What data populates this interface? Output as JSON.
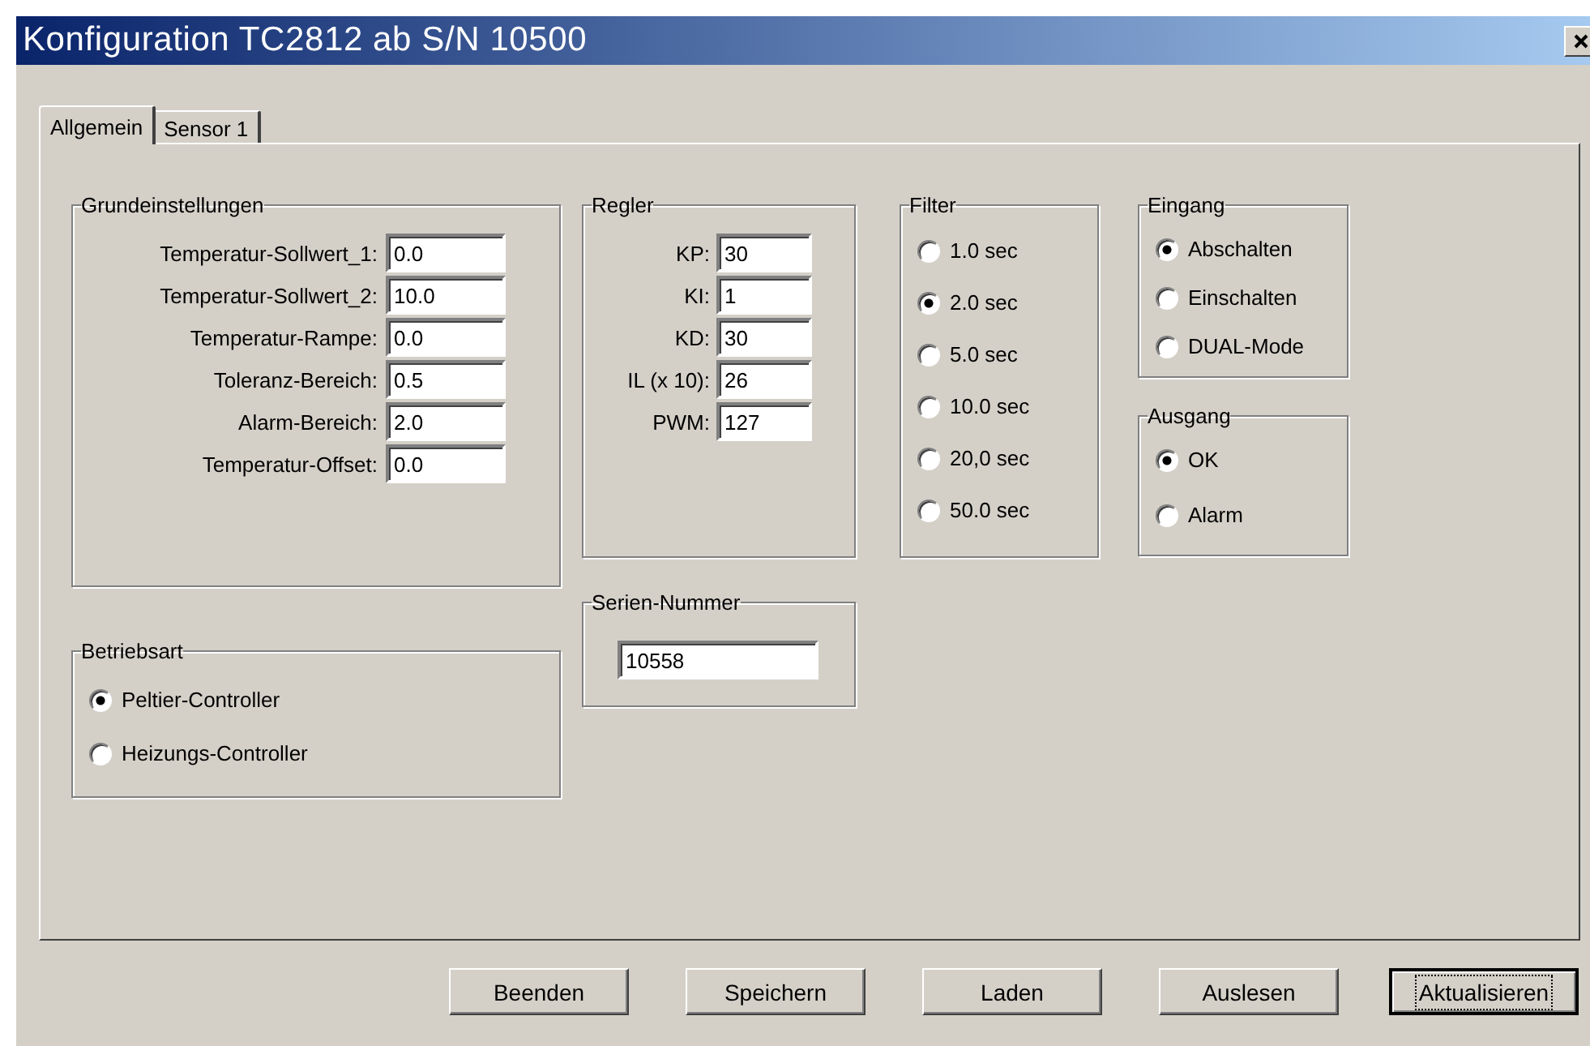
{
  "window": {
    "title": "Konfiguration TC2812 ab S/N 10500"
  },
  "tabs": [
    {
      "label": "Allgemein",
      "selected": true
    },
    {
      "label": "Sensor 1",
      "selected": false
    }
  ],
  "columns": [
    [
      {
        "kind": "fields",
        "title": "Grundeinstellungen",
        "fields": [
          {
            "label": "Temperatur-Sollwert_1:",
            "value": "0.0"
          },
          {
            "label": "Temperatur-Sollwert_2:",
            "value": "10.0"
          },
          {
            "label": "Temperatur-Rampe:",
            "value": "0.0"
          },
          {
            "label": "Toleranz-Bereich:",
            "value": "0.5"
          },
          {
            "label": "Alarm-Bereich:",
            "value": "2.0"
          },
          {
            "label": "Temperatur-Offset:",
            "value": "0.0"
          }
        ]
      },
      {
        "kind": "radios",
        "title": "Betriebsart",
        "options": [
          {
            "label": "Peltier-Controller",
            "selected": true
          },
          {
            "label": "Heizungs-Controller",
            "selected": false
          }
        ]
      }
    ],
    [
      {
        "kind": "fields",
        "title": "Regler",
        "fields": [
          {
            "label": "KP:",
            "value": "30"
          },
          {
            "label": "KI:",
            "value": "1"
          },
          {
            "label": "KD:",
            "value": "30"
          },
          {
            "label": "IL (x 10):",
            "value": "26"
          },
          {
            "label": "PWM:",
            "value": "127"
          }
        ]
      },
      {
        "kind": "field",
        "title": "Serien-Nummer",
        "value": "10558"
      }
    ],
    [
      {
        "kind": "radios",
        "title": "Filter",
        "options": [
          {
            "label": "1.0 sec",
            "selected": false
          },
          {
            "label": "2.0 sec",
            "selected": true
          },
          {
            "label": "5.0 sec",
            "selected": false
          },
          {
            "label": "10.0 sec",
            "selected": false
          },
          {
            "label": "20,0 sec",
            "selected": false
          },
          {
            "label": "50.0 sec",
            "selected": false
          }
        ]
      }
    ],
    [
      {
        "kind": "radios",
        "title": "Eingang",
        "options": [
          {
            "label": "Abschalten",
            "selected": true
          },
          {
            "label": "Einschalten",
            "selected": false
          },
          {
            "label": "DUAL-Mode",
            "selected": false
          }
        ]
      },
      {
        "kind": "radios",
        "title": "Ausgang",
        "options": [
          {
            "label": "OK",
            "selected": true
          },
          {
            "label": "Alarm",
            "selected": false
          }
        ]
      }
    ]
  ],
  "buttons": [
    {
      "label": "Beenden",
      "default": false
    },
    {
      "label": "Speichern",
      "default": false
    },
    {
      "label": "Laden",
      "default": false
    },
    {
      "label": "Auslesen",
      "default": false
    },
    {
      "label": "Aktualisieren",
      "default": true
    }
  ]
}
